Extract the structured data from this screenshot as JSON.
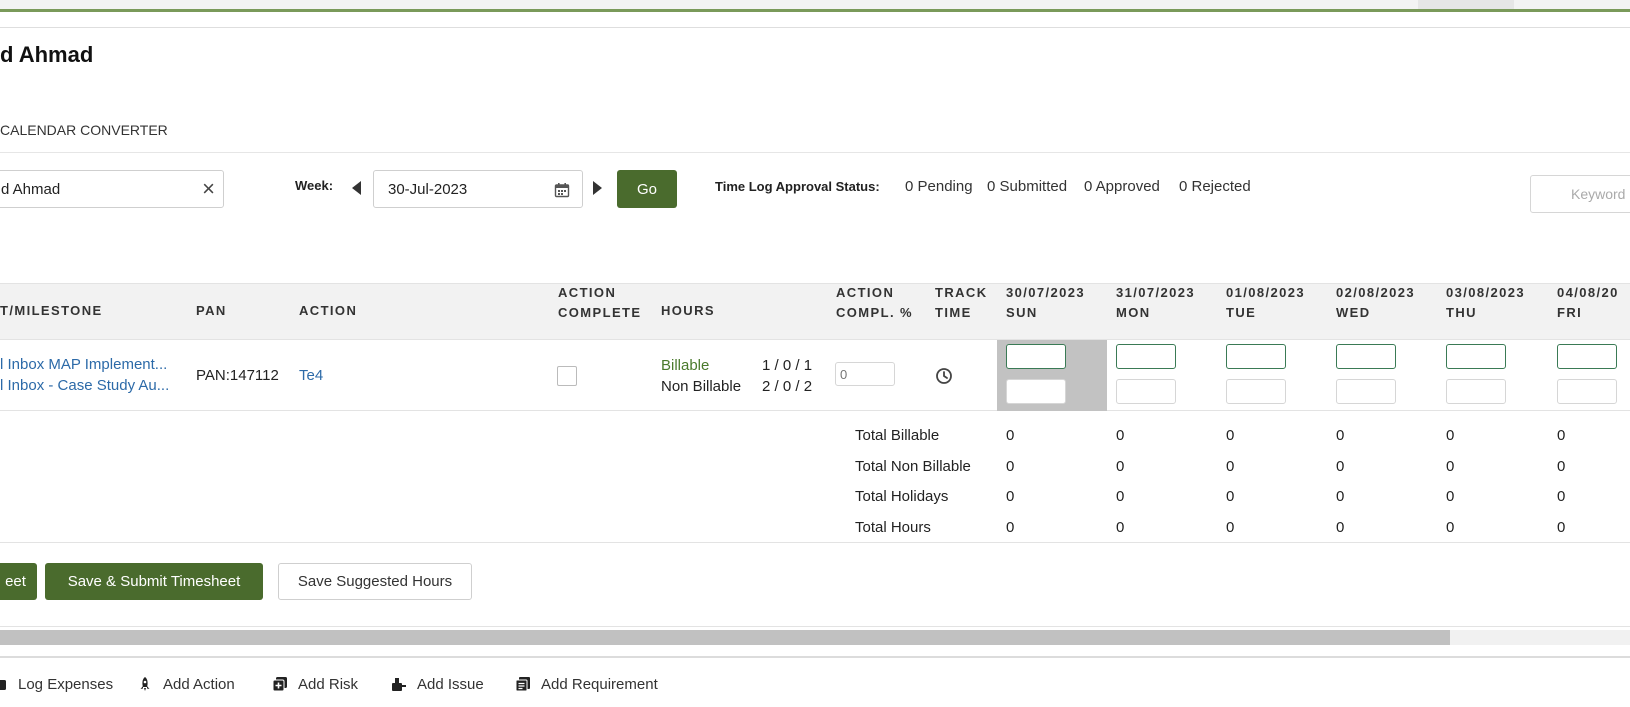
{
  "header": {
    "title": "d Ahmad",
    "calendar_link": "CALENDAR CONVERTER"
  },
  "filters": {
    "user_value": "d Ahmad",
    "week_label": "Week:",
    "week_value": "30-Jul-2023",
    "go_label": "Go",
    "approval_label": "Time Log Approval Status:",
    "pending": "0 Pending",
    "submitted": "0 Submitted",
    "approved": "0 Approved",
    "rejected": "0 Rejected",
    "keyword_placeholder": "Keyword"
  },
  "table": {
    "headers": {
      "milestone": "T/MILESTONE",
      "pan": "PAN",
      "action": "ACTION",
      "action_complete_1": "ACTION",
      "action_complete_2": "COMPLETE",
      "hours": "HOURS",
      "compl_pct_1": "ACTION",
      "compl_pct_2": "COMPL. %",
      "track_1": "TRACK",
      "track_2": "TIME"
    },
    "days": [
      {
        "date": "30/07/2023",
        "day": "SUN"
      },
      {
        "date": "31/07/2023",
        "day": "MON"
      },
      {
        "date": "01/08/2023",
        "day": "TUE"
      },
      {
        "date": "02/08/2023",
        "day": "WED"
      },
      {
        "date": "03/08/2023",
        "day": "THU"
      },
      {
        "date": "04/08/20",
        "day": "FRI"
      }
    ],
    "row": {
      "project_line1": "l Inbox MAP Implement...",
      "project_line2": "l Inbox - Case Study Au...",
      "pan": "PAN:147112",
      "action": "Te4",
      "billable_label": "Billable",
      "nonbillable_label": "Non Billable",
      "billable_hours": "1 / 0 / 1",
      "nonbillable_hours": "2 / 0 / 2",
      "compl_placeholder": "0"
    },
    "totals": [
      {
        "label": "Total Billable",
        "values": [
          "0",
          "0",
          "0",
          "0",
          "0",
          "0"
        ]
      },
      {
        "label": "Total Non Billable",
        "values": [
          "0",
          "0",
          "0",
          "0",
          "0",
          "0"
        ]
      },
      {
        "label": "Total Holidays",
        "values": [
          "0",
          "0",
          "0",
          "0",
          "0",
          "0"
        ]
      },
      {
        "label": "Total Hours",
        "values": [
          "0",
          "0",
          "0",
          "0",
          "0",
          "0"
        ]
      }
    ]
  },
  "actions": {
    "save_partial": "eet",
    "save_submit": "Save & Submit Timesheet",
    "save_suggested": "Save Suggested Hours"
  },
  "footer": {
    "log_expenses": "Log Expenses",
    "add_action": "Add Action",
    "add_risk": "Add Risk",
    "add_issue": "Add Issue",
    "add_requirement": "Add Requirement"
  },
  "colors": {
    "accent": "#4a6b2d",
    "link": "#2c6aa8",
    "billable": "#4a7a2c"
  }
}
